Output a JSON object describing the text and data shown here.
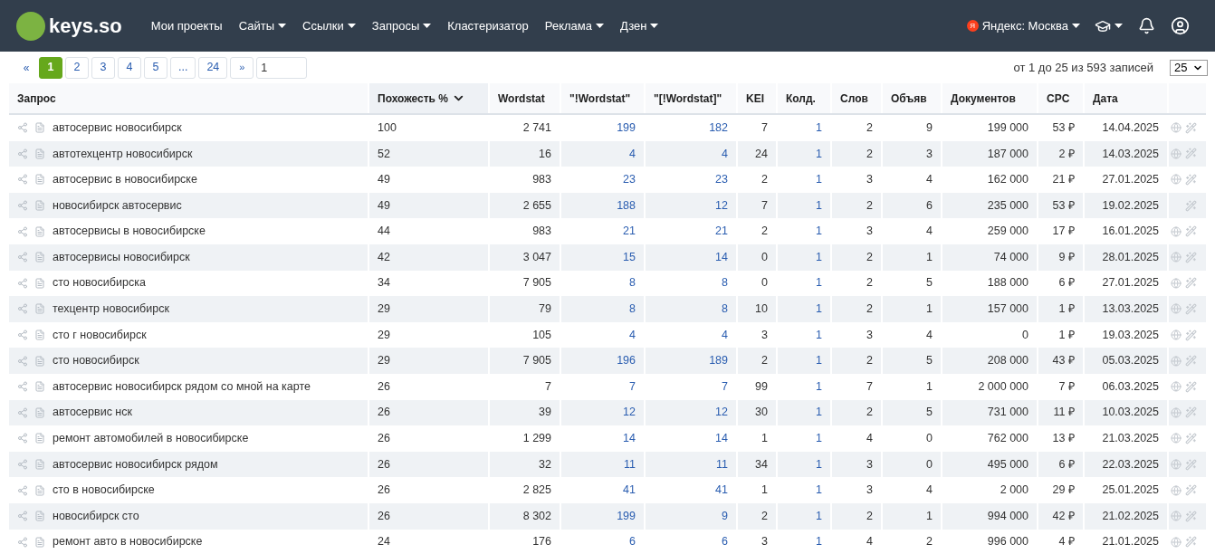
{
  "nav": {
    "logo": "keys.so",
    "items": [
      {
        "label": "Мои проекты",
        "dropdown": false
      },
      {
        "label": "Сайты",
        "dropdown": true
      },
      {
        "label": "Ссылки",
        "dropdown": true
      },
      {
        "label": "Запросы",
        "dropdown": true
      },
      {
        "label": "Кластеризатор",
        "dropdown": false
      },
      {
        "label": "Реклама",
        "dropdown": true
      },
      {
        "label": "Дзен",
        "dropdown": true
      }
    ],
    "region_badge": "Я",
    "region": "Яндекс: Москва"
  },
  "pagination": {
    "prev": "«",
    "next": "»",
    "pages": [
      {
        "label": "1",
        "selected": true
      },
      {
        "label": "2",
        "selected": false
      },
      {
        "label": "3",
        "selected": false
      },
      {
        "label": "4",
        "selected": false
      },
      {
        "label": "5",
        "selected": false
      },
      {
        "label": "...",
        "selected": false
      },
      {
        "label": "24",
        "selected": false
      }
    ],
    "goto_value": "1",
    "info": "от 1 до 25 из 593 записей",
    "per_page": "25"
  },
  "table": {
    "columns": [
      {
        "label": "Запрос",
        "sorted": false
      },
      {
        "label": "Похожесть %",
        "sorted": true
      },
      {
        "label": "Wordstat",
        "sorted": false
      },
      {
        "label": "\"!Wordstat\"",
        "sorted": false
      },
      {
        "label": "\"[!Wordstat]\"",
        "sorted": false
      },
      {
        "label": "KEI",
        "sorted": false
      },
      {
        "label": "Колд.",
        "sorted": false
      },
      {
        "label": "Слов",
        "sorted": false
      },
      {
        "label": "Объяв",
        "sorted": false
      },
      {
        "label": "Документов",
        "sorted": false
      },
      {
        "label": "CPC",
        "sorted": false
      },
      {
        "label": "Дата",
        "sorted": false
      }
    ],
    "rows": [
      {
        "cells": [
          "автосервис новосибирск",
          "100",
          "2 741",
          "199",
          "182",
          "7",
          "1",
          "2",
          "9",
          "199 000",
          "53 ₽",
          "14.04.2025"
        ],
        "globe": true
      },
      {
        "cells": [
          "автотехцентр новосибирск",
          "52",
          "16",
          "4",
          "4",
          "24",
          "1",
          "2",
          "3",
          "187 000",
          "2 ₽",
          "14.03.2025"
        ],
        "globe": true
      },
      {
        "cells": [
          "автосервис в новосибирске",
          "49",
          "983",
          "23",
          "23",
          "2",
          "1",
          "3",
          "4",
          "162 000",
          "21 ₽",
          "27.01.2025"
        ],
        "globe": true
      },
      {
        "cells": [
          "новосибирск автосервис",
          "49",
          "2 655",
          "188",
          "12",
          "7",
          "1",
          "2",
          "6",
          "235 000",
          "53 ₽",
          "19.02.2025"
        ],
        "globe": false
      },
      {
        "cells": [
          "автосервисы в новосибирске",
          "44",
          "983",
          "21",
          "21",
          "2",
          "1",
          "3",
          "4",
          "259 000",
          "17 ₽",
          "16.01.2025"
        ],
        "globe": true
      },
      {
        "cells": [
          "автосервисы новосибирск",
          "42",
          "3 047",
          "15",
          "14",
          "0",
          "1",
          "2",
          "1",
          "74 000",
          "9 ₽",
          "28.01.2025"
        ],
        "globe": true
      },
      {
        "cells": [
          "сто новосибирска",
          "34",
          "7 905",
          "8",
          "8",
          "0",
          "1",
          "2",
          "5",
          "188 000",
          "6 ₽",
          "27.01.2025"
        ],
        "globe": true
      },
      {
        "cells": [
          "техцентр новосибирск",
          "29",
          "79",
          "8",
          "8",
          "10",
          "1",
          "2",
          "1",
          "157 000",
          "1 ₽",
          "13.03.2025"
        ],
        "globe": true
      },
      {
        "cells": [
          "сто г новосибирск",
          "29",
          "105",
          "4",
          "4",
          "3",
          "1",
          "3",
          "4",
          "0",
          "1 ₽",
          "19.03.2025"
        ],
        "globe": true
      },
      {
        "cells": [
          "сто новосибирск",
          "29",
          "7 905",
          "196",
          "189",
          "2",
          "1",
          "2",
          "5",
          "208 000",
          "43 ₽",
          "05.03.2025"
        ],
        "globe": true
      },
      {
        "cells": [
          "автосервис новосибирск рядом со мной на карте",
          "26",
          "7",
          "7",
          "7",
          "99",
          "1",
          "7",
          "1",
          "2 000 000",
          "7 ₽",
          "06.03.2025"
        ],
        "globe": true
      },
      {
        "cells": [
          "автосервис нск",
          "26",
          "39",
          "12",
          "12",
          "30",
          "1",
          "2",
          "5",
          "731 000",
          "11 ₽",
          "10.03.2025"
        ],
        "globe": true
      },
      {
        "cells": [
          "ремонт автомобилей в новосибирске",
          "26",
          "1 299",
          "14",
          "14",
          "1",
          "1",
          "4",
          "0",
          "762 000",
          "13 ₽",
          "21.03.2025"
        ],
        "globe": true
      },
      {
        "cells": [
          "автосервис новосибирск рядом",
          "26",
          "32",
          "11",
          "11",
          "34",
          "1",
          "3",
          "0",
          "495 000",
          "6 ₽",
          "22.03.2025"
        ],
        "globe": true
      },
      {
        "cells": [
          "сто в новосибирске",
          "26",
          "2 825",
          "41",
          "41",
          "1",
          "1",
          "3",
          "4",
          "2 000",
          "29 ₽",
          "25.01.2025"
        ],
        "globe": true
      },
      {
        "cells": [
          "новосибирск сто",
          "26",
          "8 302",
          "199",
          "9",
          "2",
          "1",
          "2",
          "1",
          "994 000",
          "42 ₽",
          "21.02.2025"
        ],
        "globe": true
      },
      {
        "cells": [
          "ремонт авто в новосибирске",
          "24",
          "176",
          "6",
          "6",
          "3",
          "1",
          "4",
          "2",
          "996 000",
          "4 ₽",
          "21.01.2025"
        ],
        "globe": true
      }
    ]
  }
}
